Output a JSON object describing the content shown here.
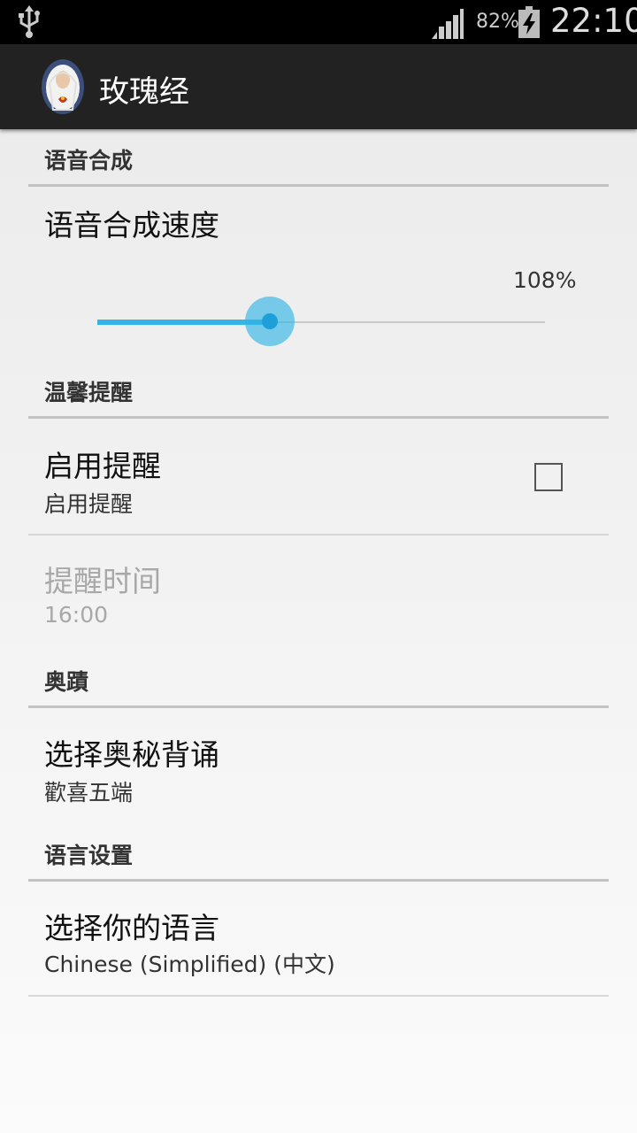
{
  "status_bar": {
    "battery_percent": "82%",
    "time": "22:10",
    "icons": [
      "usb-icon",
      "signal-icon",
      "battery-charging-icon"
    ]
  },
  "action_bar": {
    "title": "玫瑰经",
    "icon": "madonna-app-icon"
  },
  "sections": {
    "tts": {
      "header": "语音合成",
      "speed_title": "语音合成速度",
      "speed_value": "108%",
      "speed_fraction": 0.386,
      "accent_color": "#33b5e5"
    },
    "reminder": {
      "header": "温馨提醒",
      "enable_title": "启用提醒",
      "enable_summary": "启用提醒",
      "enable_checked": false,
      "time_title": "提醒时间",
      "time_summary": "16:00"
    },
    "mysteries": {
      "header": "奥蹟",
      "choose_title": "选择奥秘背诵",
      "choose_summary": "歡喜五端"
    },
    "language": {
      "header": "语言设置",
      "choose_title": "选择你的语言",
      "choose_summary": "Chinese (Simplified) (中文)"
    }
  }
}
